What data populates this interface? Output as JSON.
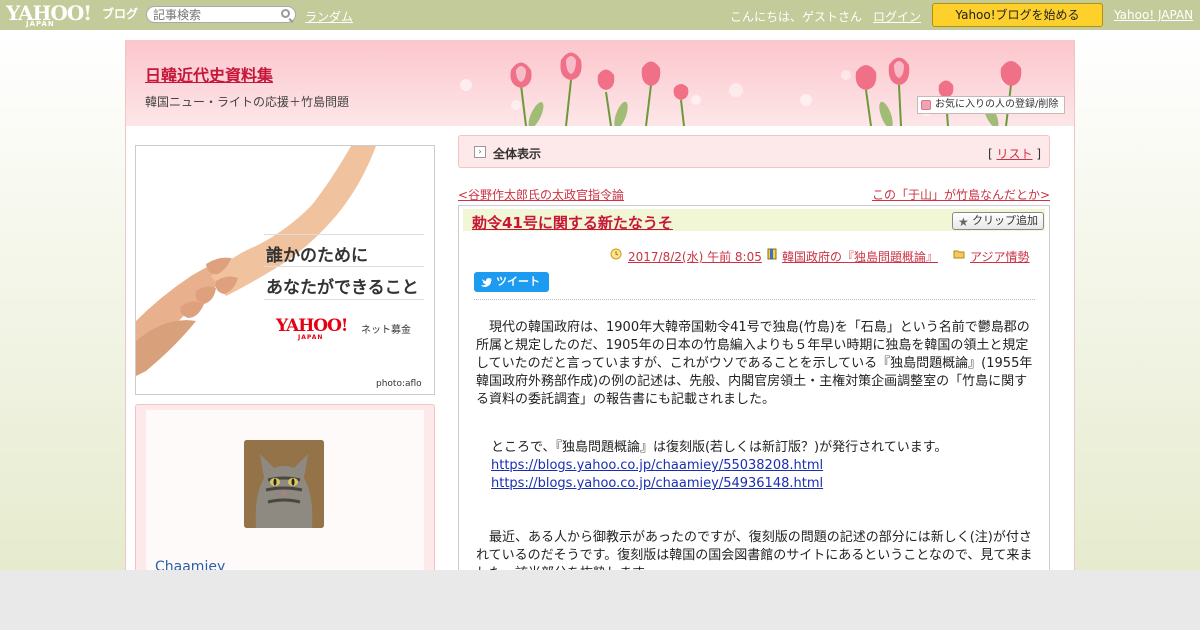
{
  "topbar": {
    "logo_text": "YAHOO!",
    "logo_sub": "JAPAN",
    "logo_blog": "ブログ",
    "search_placeholder": "記事検索",
    "random_link": "ランダム",
    "greeting": "こんにちは、ゲストさん",
    "login_link": "ログイン",
    "start_button": "Yahoo!ブログを始める",
    "yahoo_japan_link": "Yahoo! JAPAN"
  },
  "header": {
    "blog_title": "日韓近代史資料集",
    "blog_description": "韓国ニュー・ライトの応援＋竹島問題",
    "favorite_button": "お気に入りの人の登録/削除"
  },
  "sidebar": {
    "banner": {
      "line1": "誰かのために",
      "line2": "あなたができること",
      "logo": "YAHOO!",
      "logo_sub": "JAPAN",
      "caption": "ネット募金",
      "credit": "photo:aflo"
    },
    "profile": {
      "name": "Chaamiey",
      "avatar": "cat-photo"
    }
  },
  "main": {
    "menubar": {
      "all_label": "全体表示",
      "list_open": "[ ",
      "list_link": "リスト",
      "list_close": " ]"
    },
    "nav": {
      "prev": "<谷野作太郎氏の太政官指令論",
      "next": "この「于山」が竹島なんだとか>"
    },
    "article": {
      "title": "勅令41号に関する新たなうそ",
      "clip_button": "クリップ追加",
      "date": "2017/8/2(水) 午前 8:05",
      "category1": "韓国政府の『独島問題概論』",
      "category2": "アジア情勢",
      "tweet_button": "ツイート",
      "paragraph1": "　現代の韓国政府は、1900年大韓帝国勅令41号で独島(竹島)を「石島」という名前で鬱島郡の所属と規定したのだ、1905年の日本の竹島編入よりも５年早い時期に独島を韓国の領土と規定していたのだと言っていますが、これがウソであることを示している『独島問題概論』(1955年韓国政府外務部作成)の例の記述は、先般、内閣官房領土・主権対策企画調整室の「竹島に関する資料の委託調査」の報告書にも記載されました。",
      "paragraph2": "ところで、『独島問題概論』は復刻版(若しくは新訂版？)が発行されています。",
      "link1": "https://blogs.yahoo.co.jp/chaamiey/55038208.html",
      "link2": "https://blogs.yahoo.co.jp/chaamiey/54936148.html",
      "paragraph3": "　最近、ある人から御教示があったのですが、復刻版の問題の記述の部分には新しく(注)が付されているのだそうです。復刻版は韓国の国会図書館のサイトにあるということなので、見て来ました。該当部分を抜粋します。"
    }
  },
  "colors": {
    "topbar": "#c4cb9a",
    "accent": "#c8163a",
    "header_pink": "#fbc6cc",
    "start_button": "#fed02c",
    "tweet": "#1d9bf0"
  }
}
